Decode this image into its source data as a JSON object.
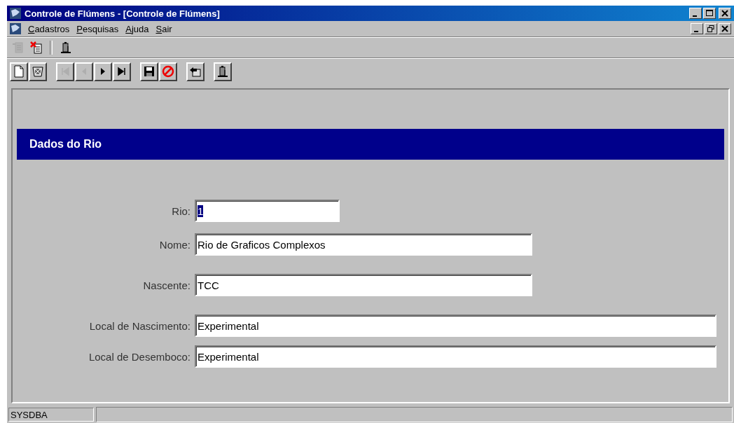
{
  "window": {
    "title": "Controle de Flúmens - [Controle de Flúmens]"
  },
  "menu": [
    "Cadastros",
    "Pesquisas",
    "Ajuda",
    "Sair"
  ],
  "toolbar_top": [
    {
      "buttons": [
        {
          "kind": "list",
          "disabled": true
        },
        {
          "kind": "delete",
          "disabled": false
        }
      ]
    },
    {
      "buttons": [
        {
          "kind": "exit",
          "disabled": false
        }
      ]
    }
  ],
  "toolbar": [
    {
      "buttons": [
        {
          "kind": "new",
          "disabled": false
        },
        {
          "kind": "erase",
          "disabled": false
        }
      ]
    },
    {
      "buttons": [
        {
          "kind": "first",
          "disabled": true
        },
        {
          "kind": "prev",
          "disabled": true
        },
        {
          "kind": "next",
          "disabled": false
        },
        {
          "kind": "last",
          "disabled": false
        }
      ]
    },
    {
      "buttons": [
        {
          "kind": "save",
          "disabled": false
        },
        {
          "kind": "cancel",
          "disabled": false
        }
      ]
    },
    {
      "buttons": [
        {
          "kind": "back",
          "disabled": false
        }
      ]
    },
    {
      "buttons": [
        {
          "kind": "exit",
          "disabled": false
        }
      ]
    }
  ],
  "panel": {
    "title": "Dados do Rio"
  },
  "fields": [
    {
      "label": "Rio:",
      "value": "1",
      "value_selected": true
    },
    {
      "label": "Nome:",
      "value": "Rio de Graficos Complexos",
      "value_selected": false
    },
    {
      "label": "Nascente:",
      "value": "TCC",
      "value_selected": false
    },
    {
      "label": "Local de Nascimento:",
      "value": "Experimental",
      "value_selected": false
    },
    {
      "label": "Local de Desemboco:",
      "value": "Experimental",
      "value_selected": false
    }
  ],
  "status_bar": {
    "user": "SYSDBA"
  }
}
